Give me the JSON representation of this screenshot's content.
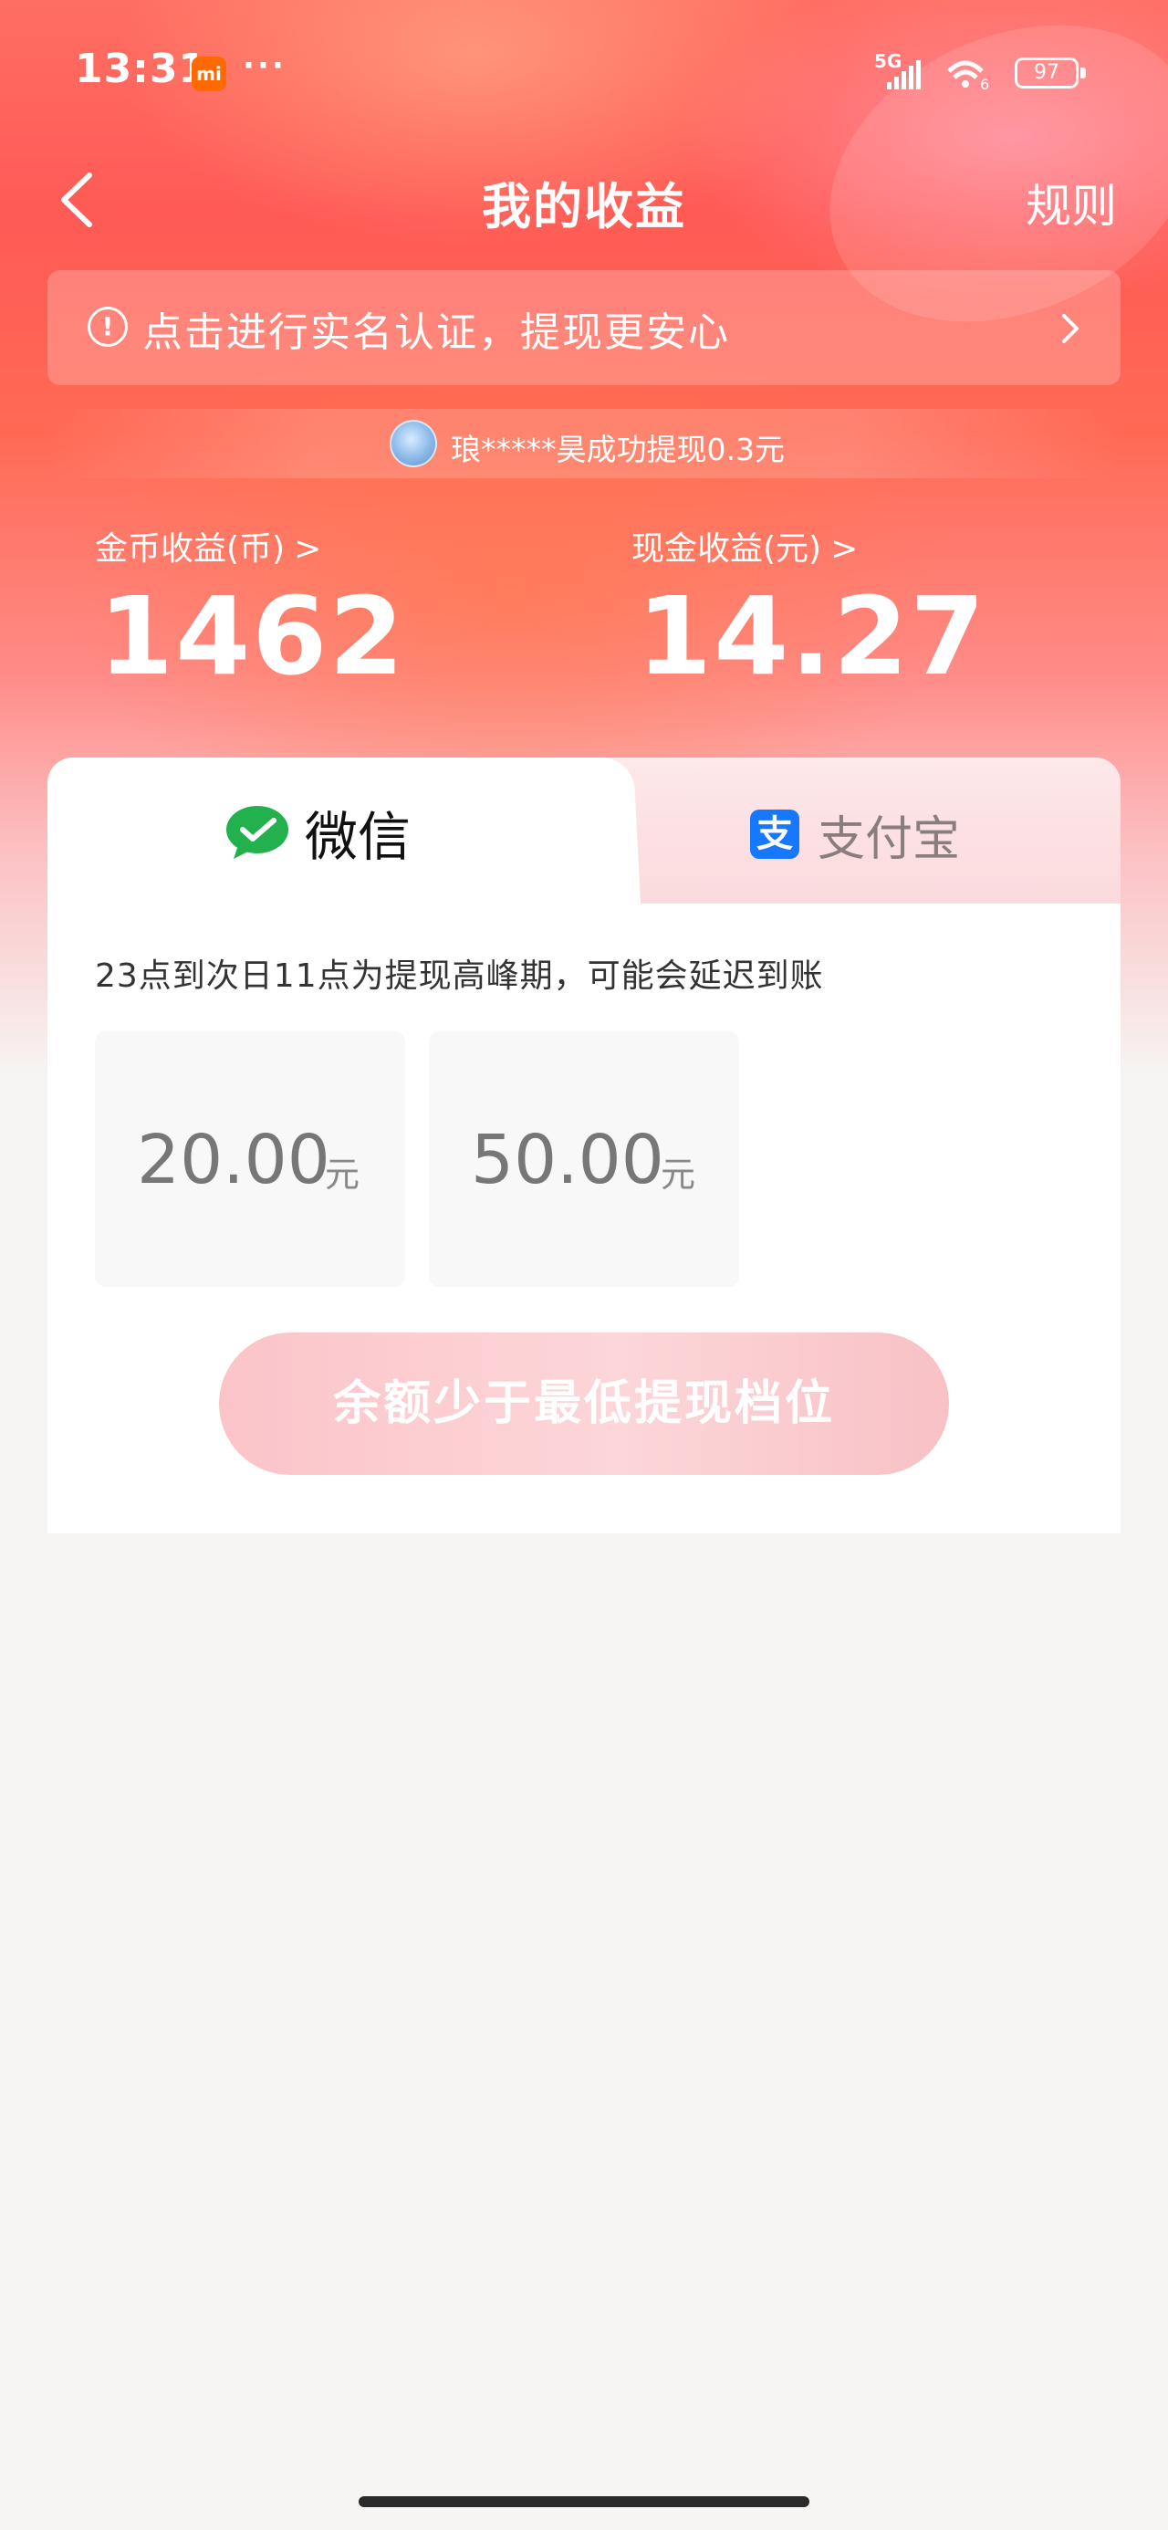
{
  "status_bar": {
    "time": "13:31",
    "app_badge": "mi",
    "more": "···",
    "network": "5G",
    "wifi_sub": "6",
    "battery": "97"
  },
  "nav": {
    "title": "我的收益",
    "rule_link": "规则"
  },
  "verify_banner": {
    "text": "点击进行实名认证，提现更安心",
    "icon": "!"
  },
  "ticker": {
    "text": "琅*****昊成功提现0.3元"
  },
  "balances": {
    "coin_label": "金币收益(币)",
    "coin_value": "1462",
    "cash_label": "现金收益(元)",
    "cash_value": "14.27",
    "arrow": ">"
  },
  "tabs": {
    "wechat": "微信",
    "alipay": "支付宝",
    "alipay_glyph": "支",
    "active": "wechat"
  },
  "notice": "23点到次日11点为提现高峰期，可能会延迟到账",
  "amounts": [
    {
      "value": "20.00",
      "unit": "元"
    },
    {
      "value": "50.00",
      "unit": "元"
    }
  ],
  "withdraw_button": "余额少于最低提现档位",
  "colors": {
    "header_gradient_top": "#ff5a55",
    "button_disabled": "#fbc4c9",
    "alipay_blue": "#1677ff",
    "wechat_green": "#22b14c"
  }
}
